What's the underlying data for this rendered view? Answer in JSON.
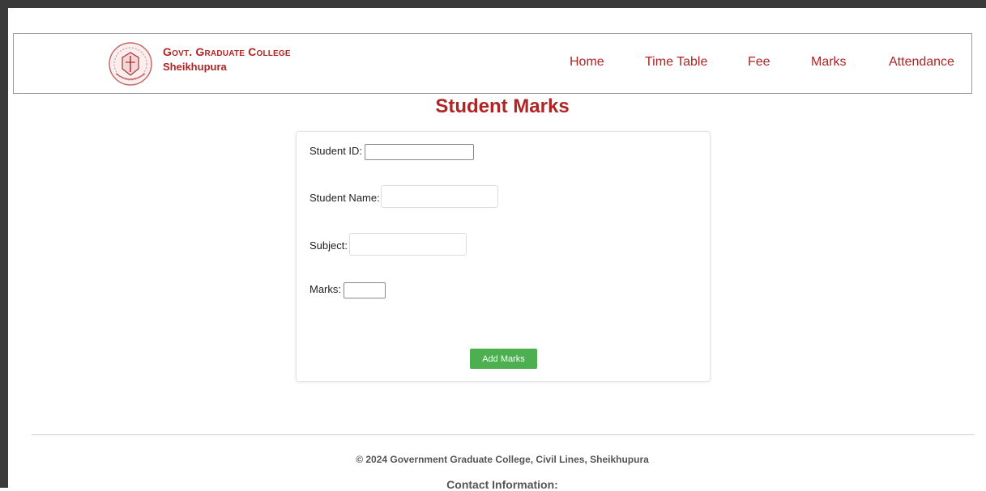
{
  "brand": {
    "name": "Govt. Graduate College",
    "city": "Sheikhupura"
  },
  "nav": {
    "home": "Home",
    "timetable": "Time Table",
    "fee": "Fee",
    "marks": "Marks",
    "attendance": "Attendance"
  },
  "page": {
    "title": "Student Marks"
  },
  "form": {
    "student_id_label": "Student ID:",
    "student_id_value": "",
    "student_name_label": "Student Name:",
    "student_name_value": "",
    "subject_label": "Subject:",
    "subject_value": "",
    "marks_label": "Marks:",
    "marks_value": "",
    "submit_label": "Add Marks"
  },
  "footer": {
    "copyright": "© 2024 Government Graduate College, Civil Lines, Sheikhupura",
    "contact_heading": "Contact Information:"
  },
  "colors": {
    "brand_red": "#b02424",
    "button_green": "#4caf50"
  }
}
